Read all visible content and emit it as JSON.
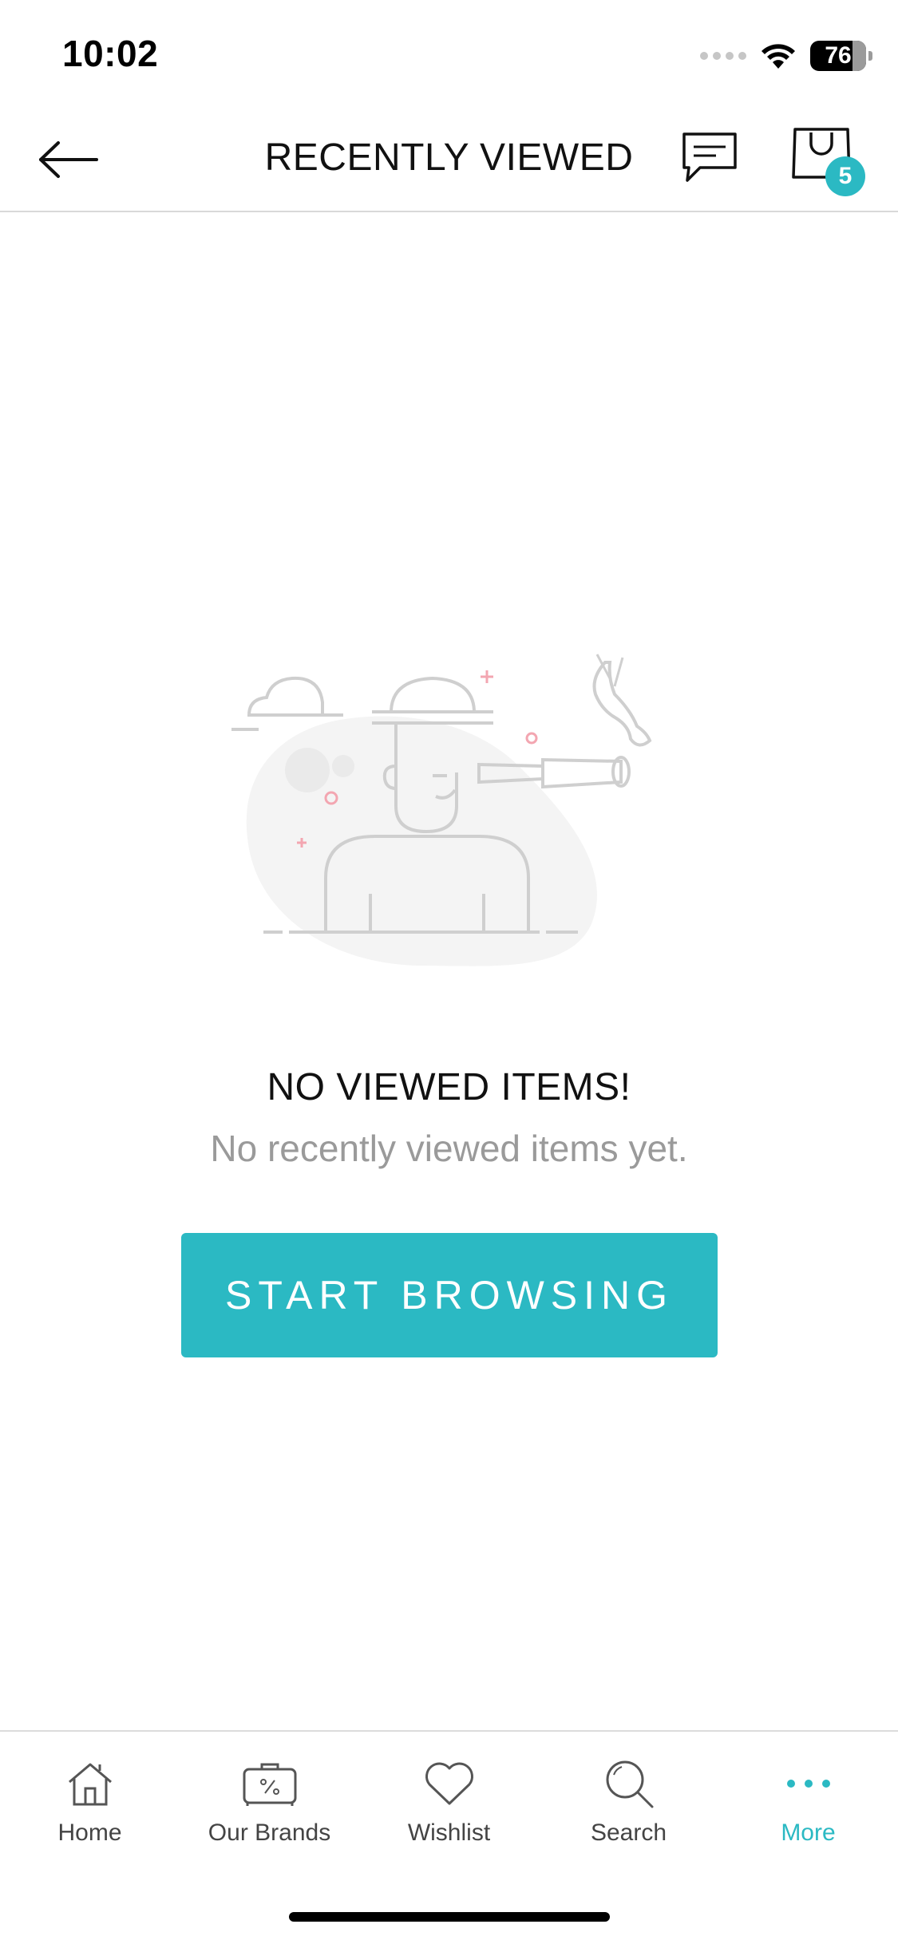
{
  "status_bar": {
    "time": "10:02",
    "battery": "76",
    "battery_fraction": 0.76
  },
  "header": {
    "title": "RECENTLY VIEWED",
    "cart_count": "5"
  },
  "empty_state": {
    "title": "NO VIEWED ITEMS!",
    "subtitle": "No recently viewed items yet.",
    "button_label": "START BROWSING"
  },
  "tabs": [
    {
      "label": "Home",
      "icon": "home-icon"
    },
    {
      "label": "Our Brands",
      "icon": "brands-icon"
    },
    {
      "label": "Wishlist",
      "icon": "heart-icon"
    },
    {
      "label": "Search",
      "icon": "search-icon"
    },
    {
      "label": "More",
      "icon": "more-icon",
      "active": true
    }
  ],
  "colors": {
    "accent": "#2bb9c3",
    "muted_text": "#9a9a9a",
    "illustration_pink": "#f3a6b1",
    "illustration_gray": "#cfcfcf"
  }
}
